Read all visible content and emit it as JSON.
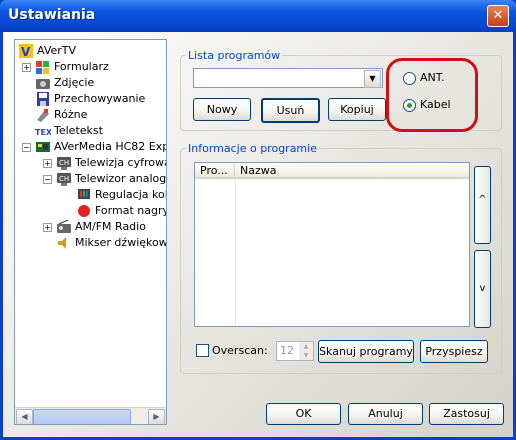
{
  "window": {
    "title": "Ustawiania",
    "close_symbol": "✕"
  },
  "tree": {
    "items": [
      {
        "label": "AVerTV",
        "icon": "avertv-icon"
      },
      {
        "label": "Formularz",
        "icon": "form-icon"
      },
      {
        "label": "Zdjęcie",
        "icon": "camera-icon"
      },
      {
        "label": "Przechowywanie",
        "icon": "disk-icon"
      },
      {
        "label": "Różne",
        "icon": "misc-icon"
      },
      {
        "label": "Teletekst",
        "icon": "text-icon"
      },
      {
        "label": "AVerMedia HC82 Exp",
        "icon": "device-icon"
      },
      {
        "label": "Telewizja cyfrowa",
        "icon": "tv-icon"
      },
      {
        "label": "Telewizor analogo",
        "icon": "tv-icon"
      },
      {
        "label": "Regulacja kol",
        "icon": "color-icon"
      },
      {
        "label": "Format nagryw",
        "icon": "record-icon"
      },
      {
        "label": "AM/FM Radio",
        "icon": "radio-icon"
      },
      {
        "label": "Mikser dźwiękowy",
        "icon": "speaker-icon"
      }
    ]
  },
  "programs": {
    "legend": "Lista programów",
    "combo_value": "",
    "new_label": "Nowy",
    "delete_label": "Usuń",
    "copy_label": "Kopiuj",
    "ant_label": "ANT.",
    "cable_label": "Kabel",
    "selected_source": "Kabel"
  },
  "info": {
    "legend": "Informacje o programie",
    "columns": [
      "Pro...",
      "Nazwa"
    ],
    "up_symbol": "^",
    "down_symbol": "v",
    "overscan_label": "Overscan:",
    "overscan_value": "12",
    "scan_label": "Skanuj programy",
    "speed_label": "Przyspiesz"
  },
  "footer": {
    "ok_label": "OK",
    "cancel_label": "Anuluj",
    "apply_label": "Zastosuj"
  },
  "colors": {
    "titlebar": "#0c56e0",
    "highlight_ring": "#d01010",
    "legend_text": "#0046d5"
  }
}
